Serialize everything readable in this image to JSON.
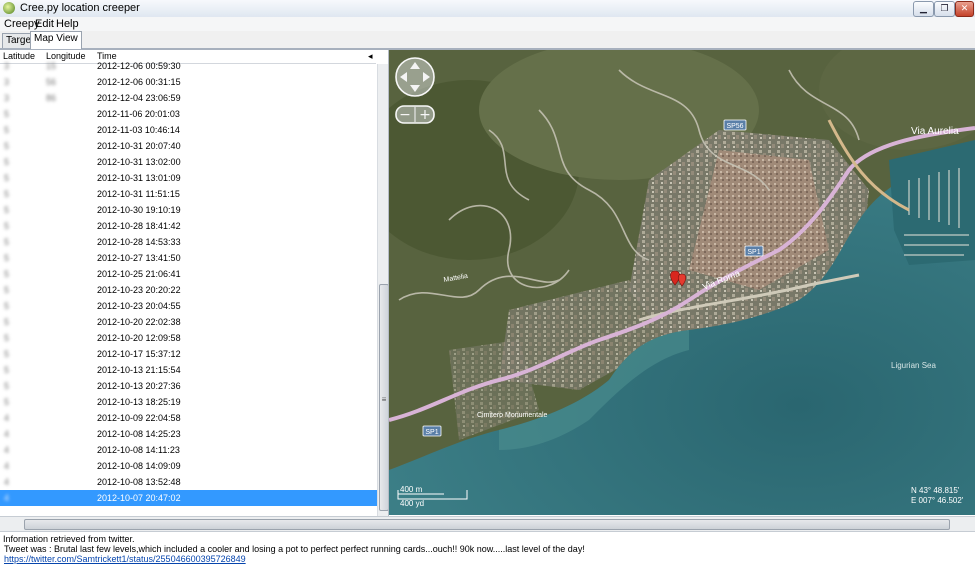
{
  "window": {
    "title": "Cree.py location creeper",
    "controls": {
      "minimize": "▁",
      "maximize": "❐",
      "close": "✕"
    }
  },
  "menu": [
    "Creepy",
    "Edit",
    "Help"
  ],
  "tabs": [
    "Targets",
    "Map View"
  ],
  "table": {
    "headers": {
      "latitude": "Latitude",
      "longitude": "Longitude",
      "time": "Time"
    },
    "sort_indicator": "◂",
    "rows": [
      {
        "lat": "3",
        "lon": "15",
        "time": "2012-12-06 00:59:30"
      },
      {
        "lat": "3",
        "lon": "56",
        "time": "2012-12-06 00:31:15"
      },
      {
        "lat": "3",
        "lon": "86",
        "time": "2012-12-04 23:06:59"
      },
      {
        "lat": "5",
        "lon": "",
        "time": "2012-11-06 20:01:03"
      },
      {
        "lat": "5",
        "lon": "",
        "time": "2012-11-03 10:46:14"
      },
      {
        "lat": "5",
        "lon": "",
        "time": "2012-10-31 20:07:40"
      },
      {
        "lat": "5",
        "lon": "",
        "time": "2012-10-31 13:02:00"
      },
      {
        "lat": "5",
        "lon": "",
        "time": "2012-10-31 13:01:09"
      },
      {
        "lat": "5",
        "lon": "",
        "time": "2012-10-31 11:51:15"
      },
      {
        "lat": "5",
        "lon": "",
        "time": "2012-10-30 19:10:19"
      },
      {
        "lat": "5",
        "lon": "",
        "time": "2012-10-28 18:41:42"
      },
      {
        "lat": "5",
        "lon": "",
        "time": "2012-10-28 14:53:33"
      },
      {
        "lat": "5",
        "lon": "",
        "time": "2012-10-27 13:41:50"
      },
      {
        "lat": "5",
        "lon": "",
        "time": "2012-10-25 21:06:41"
      },
      {
        "lat": "5",
        "lon": "",
        "time": "2012-10-23 20:20:22"
      },
      {
        "lat": "5",
        "lon": "",
        "time": "2012-10-23 20:04:55"
      },
      {
        "lat": "5",
        "lon": "",
        "time": "2012-10-20 22:02:38"
      },
      {
        "lat": "5",
        "lon": "",
        "time": "2012-10-20 12:09:58"
      },
      {
        "lat": "5",
        "lon": "",
        "time": "2012-10-17 15:37:12"
      },
      {
        "lat": "5",
        "lon": "",
        "time": "2012-10-13 21:15:54"
      },
      {
        "lat": "5",
        "lon": "",
        "time": "2012-10-13 20:27:36"
      },
      {
        "lat": "5",
        "lon": "",
        "time": "2012-10-13 18:25:19"
      },
      {
        "lat": "4",
        "lon": "",
        "time": "2012-10-09 22:04:58"
      },
      {
        "lat": "4",
        "lon": "",
        "time": "2012-10-08 14:25:23"
      },
      {
        "lat": "4",
        "lon": "",
        "time": "2012-10-08 14:11:23"
      },
      {
        "lat": "4",
        "lon": "",
        "time": "2012-10-08 14:09:09"
      },
      {
        "lat": "4",
        "lon": "",
        "time": "2012-10-08 13:52:48"
      },
      {
        "lat": "4",
        "lon": "",
        "time": "2012-10-07 20:47:02"
      }
    ],
    "selected_row": 27,
    "grip": "≡"
  },
  "map": {
    "labels": {
      "via_aurelia": "Via Aurelia",
      "via_roma": "Via Roma",
      "sea": "Ligurian Sea",
      "sp56": "SP56",
      "sp1_top": "SP1",
      "sp1_bottom": "SP1",
      "cimitero": "Cimitero Monumentale",
      "mattelia": "Mattelia"
    },
    "scale": {
      "m": "400 m",
      "yd": "400 yd"
    },
    "coords": {
      "lat": "N 43° 48.815'",
      "lon": "E 007° 46.502'"
    },
    "zoom": {
      "minus": "−",
      "plus": "+"
    }
  },
  "info": {
    "line1": "Information retrieved from twitter.",
    "line2": "Tweet was : Brutal last few levels,which included a cooler and losing a pot to perfect perfect running cards...ouch!! 90k now.....last level of the day!",
    "link": "https://twitter.com/Samtrickett1/status/255046600395726849"
  },
  "colors": {
    "selection": "#3399ff",
    "road": "#d8b3d6",
    "sea": "#2f6e78"
  }
}
